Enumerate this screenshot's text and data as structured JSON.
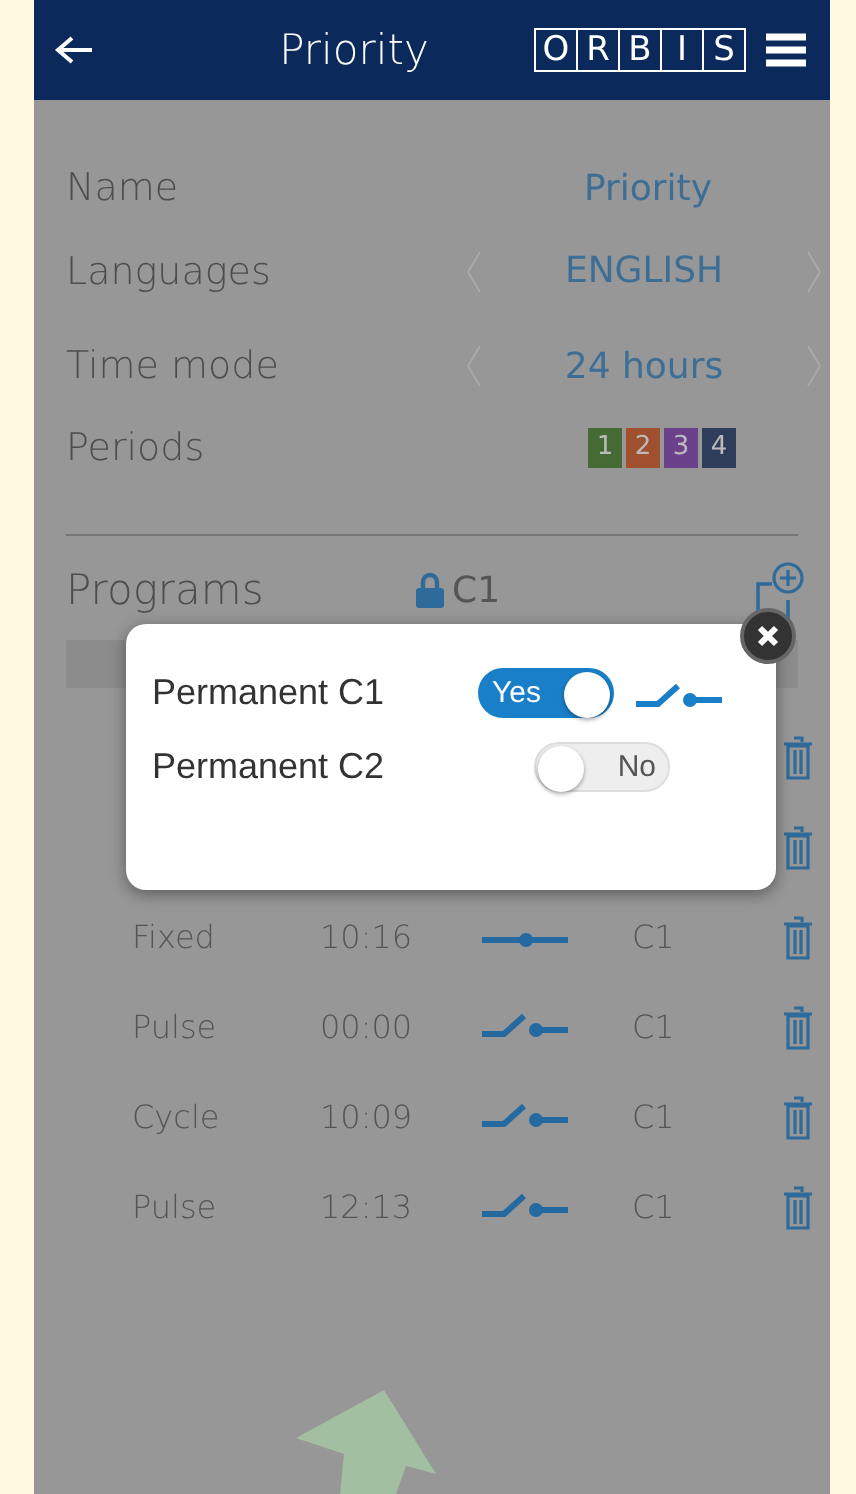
{
  "header": {
    "title": "Priority",
    "logo_letters": [
      "O",
      "R",
      "B",
      "I",
      "S"
    ]
  },
  "settings": [
    {
      "kind": "text",
      "label": "Name",
      "value": "Priority"
    },
    {
      "kind": "stepper",
      "label": "Languages",
      "value": "ENGLISH"
    },
    {
      "kind": "stepper",
      "label": "Time mode",
      "value": "24 hours"
    },
    {
      "kind": "periods",
      "label": "Periods",
      "periods": [
        {
          "label": "1",
          "color": "#466a33"
        },
        {
          "label": "2",
          "color": "#a0502f"
        },
        {
          "label": "3",
          "color": "#6a418a"
        },
        {
          "label": "4",
          "color": "#2e3d5a"
        }
      ]
    }
  ],
  "programs": {
    "title": "Programs",
    "locked": true,
    "channel": "C1",
    "rows": [
      {
        "type": "Fixed",
        "time": "10:16",
        "contact_closed": true,
        "channel": "C1"
      },
      {
        "type": "Pulse",
        "time": "00:00",
        "contact_closed": false,
        "channel": "C1"
      },
      {
        "type": "Cycle",
        "time": "10:09",
        "contact_closed": false,
        "channel": "C1"
      },
      {
        "type": "Pulse",
        "time": "12:13",
        "contact_closed": false,
        "channel": "C1"
      }
    ]
  },
  "dialog": {
    "options": [
      {
        "label": "Permanent C1",
        "on": true,
        "toggle_text": "Yes",
        "contact_closed": false
      },
      {
        "label": "Permanent C2",
        "on": false,
        "toggle_text": "No"
      }
    ]
  }
}
